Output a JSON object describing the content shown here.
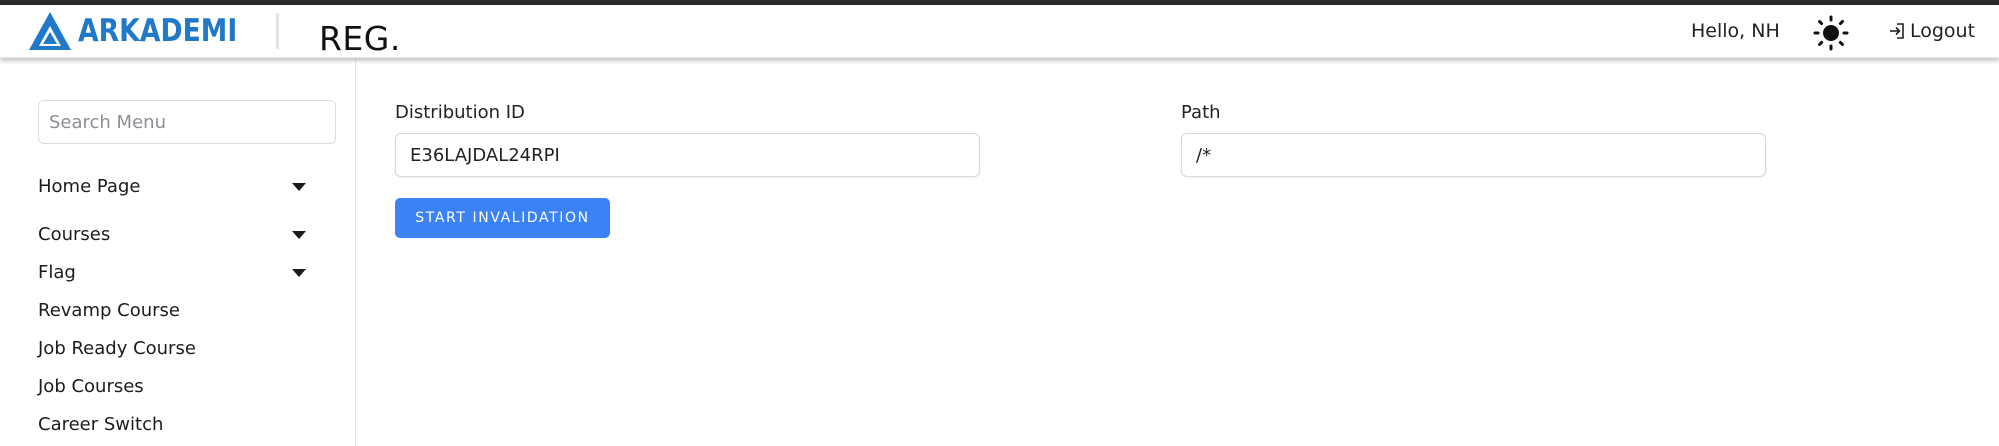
{
  "header": {
    "logo_text": "ARKADEMI",
    "app_title": "REG.",
    "greeting": "Hello, NH",
    "theme_icon": "sun-icon",
    "logout_label": "Logout"
  },
  "sidebar": {
    "search_placeholder": "Search Menu",
    "items": [
      {
        "label": "Home Page",
        "has_submenu": true
      },
      {
        "label": "Courses",
        "has_submenu": true
      },
      {
        "label": "Flag",
        "has_submenu": true
      },
      {
        "label": "Revamp Course",
        "has_submenu": false
      },
      {
        "label": "Job Ready Course",
        "has_submenu": false
      },
      {
        "label": "Job Courses",
        "has_submenu": false
      },
      {
        "label": "Career Switch",
        "has_submenu": false
      }
    ]
  },
  "form": {
    "distribution_id_label": "Distribution ID",
    "distribution_id_value": "E36LAJDAL24RPI",
    "path_label": "Path",
    "path_value": "/*",
    "submit_label": "START INVALIDATION"
  },
  "colors": {
    "brand": "#1f78c8",
    "primary_button": "#3b82f6"
  }
}
